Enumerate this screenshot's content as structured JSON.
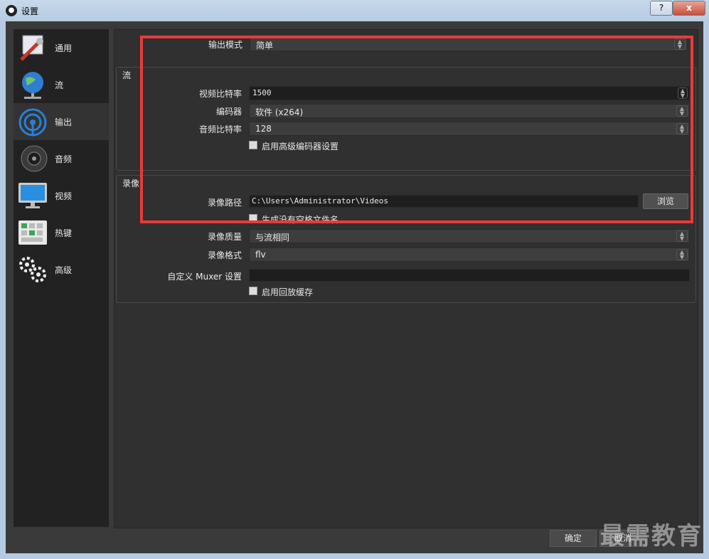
{
  "window": {
    "title": "设置",
    "help_label": "?",
    "close_label": "x"
  },
  "sidebar": {
    "items": [
      {
        "label": "通用",
        "icon": "wrench-icon"
      },
      {
        "label": "流",
        "icon": "globe-icon"
      },
      {
        "label": "输出",
        "icon": "broadcast-icon"
      },
      {
        "label": "音频",
        "icon": "speaker-icon"
      },
      {
        "label": "视频",
        "icon": "monitor-icon"
      },
      {
        "label": "热键",
        "icon": "keyboard-icon"
      },
      {
        "label": "高级",
        "icon": "gears-icon"
      }
    ],
    "active_index": 2
  },
  "output_mode": {
    "label": "输出模式",
    "value": "简单"
  },
  "stream_group": {
    "title": "流",
    "video_bitrate": {
      "label": "视频比特率",
      "value": "1500"
    },
    "encoder": {
      "label": "编码器",
      "value": "软件 (x264)"
    },
    "audio_bitrate": {
      "label": "音频比特率",
      "value": "128"
    },
    "advanced_encoder": {
      "label": "启用高级编码器设置",
      "checked": false
    }
  },
  "record_group": {
    "title": "录像",
    "path": {
      "label": "录像路径",
      "value": "C:\\Users\\Administrator\\Videos",
      "browse_label": "浏览"
    },
    "no_space_filename": {
      "label": "生成没有空格文件名",
      "checked": false
    },
    "quality": {
      "label": "录像质量",
      "value": "与流相同"
    },
    "format": {
      "label": "录像格式",
      "value": "flv"
    },
    "muxer": {
      "label": "自定义 Muxer 设置",
      "value": ""
    },
    "replay_buffer": {
      "label": "启用回放缓存",
      "checked": false
    }
  },
  "footer": {
    "ok_label": "确定",
    "cancel_label": "取消"
  },
  "watermark": "最需教育",
  "colors": {
    "highlight": "#e83a3a",
    "background": "#3a3a3a",
    "sidebar": "#222222"
  }
}
